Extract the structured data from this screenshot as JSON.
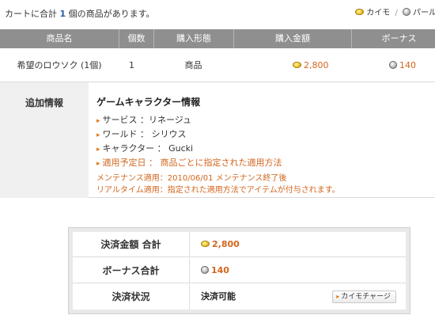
{
  "cart": {
    "message_prefix": "カートに合計",
    "count": "1",
    "message_suffix": "個の商品があります。"
  },
  "legend": {
    "gold_label": "カイモ",
    "separator": "/",
    "silver_label": "パール"
  },
  "table": {
    "headers": [
      "商品名",
      "個数",
      "購入形態",
      "購入金額",
      "ボーナス"
    ],
    "rows": [
      {
        "name": "希望のロウソク (1個)",
        "qty": "1",
        "type": "商品",
        "price": "2,800",
        "bonus": "140"
      }
    ]
  },
  "additional_info": {
    "label": "追加情報",
    "title": "ゲームキャラクター情報",
    "lines": [
      "サービス ：リネージュ",
      "ワールド ： シリウス",
      "キャラクター ： Gucki",
      "適用予定日 ： 商品ごとに指定された適用方法"
    ],
    "notes": [
      "メンテナンス適用：2010/06/01 メンテナンス終了後",
      "リアルタイム適用：指定された適用方法でアイテムが付与されます。"
    ]
  },
  "summary": {
    "total_label": "決済金額 合計",
    "total_value": "2,800",
    "bonus_label": "ボーナス合計",
    "bonus_value": "140",
    "status_label": "決済状況",
    "status_value": "決済可能",
    "charge_button": "カイモチャージ"
  },
  "colors": {
    "header_bg": "#8f8f8f",
    "accent_orange": "#d2661d",
    "count_blue": "#2a5fa8"
  },
  "icons": {
    "gold": "gold-coin-icon",
    "silver": "silver-coin-icon"
  }
}
